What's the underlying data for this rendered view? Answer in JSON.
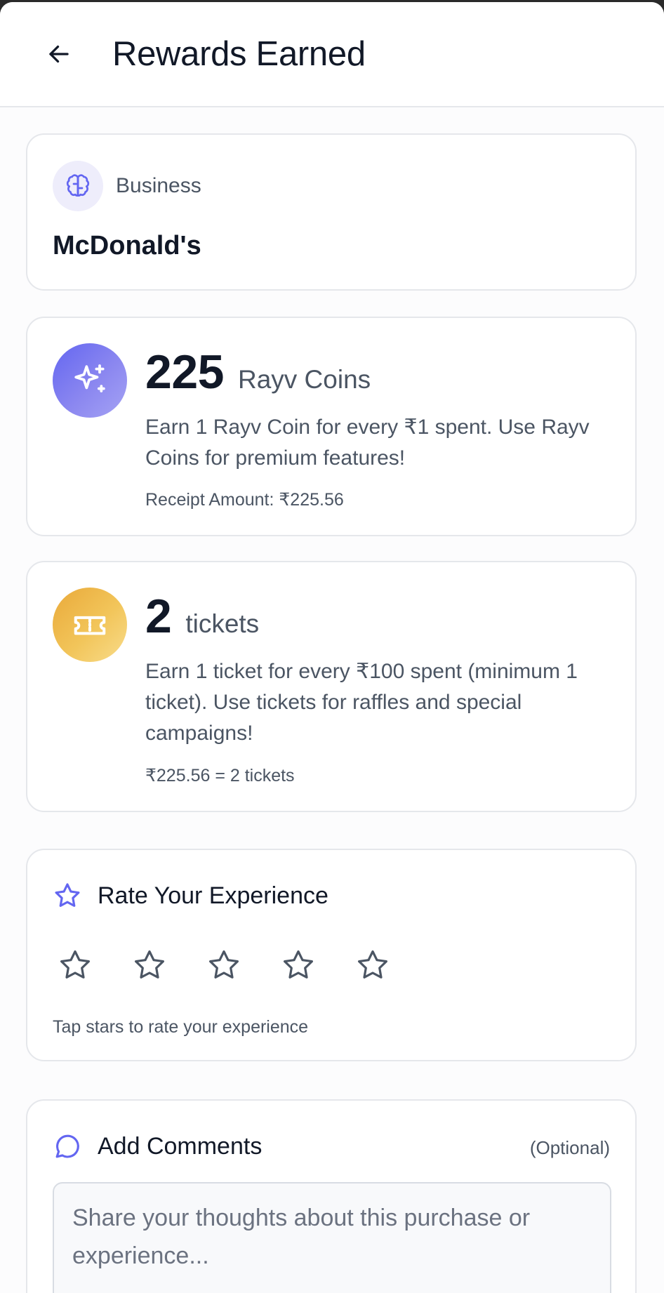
{
  "header": {
    "title": "Rewards Earned",
    "back_icon": "arrow-left-icon"
  },
  "business": {
    "label": "Business",
    "name": "McDonald's",
    "icon": "brain-icon",
    "icon_color": "#6366f1"
  },
  "coins": {
    "amount": "225",
    "unit": "Rayv Coins",
    "description": "Earn 1 Rayv Coin for every ₹1 spent. Use Rayv Coins for premium features!",
    "receipt": "Receipt Amount: ₹225.56",
    "icon": "sparkles-icon",
    "color": "#6366f1"
  },
  "tickets": {
    "amount": "2",
    "unit": "tickets",
    "description": "Earn 1 ticket for every ₹100 spent (minimum 1 ticket). Use tickets for raffles and special campaigns!",
    "calculation": "₹225.56 = 2 tickets",
    "icon": "ticket-icon",
    "color": "#eeb246"
  },
  "rating": {
    "title": "Rate Your Experience",
    "hint": "Tap stars to rate your experience",
    "value": 0,
    "max": 5,
    "title_icon": "star-icon"
  },
  "comments": {
    "title": "Add Comments",
    "optional": "(Optional)",
    "placeholder": "Share your thoughts about this purchase or experience...",
    "value": "",
    "icon": "chat-bubble-icon"
  }
}
